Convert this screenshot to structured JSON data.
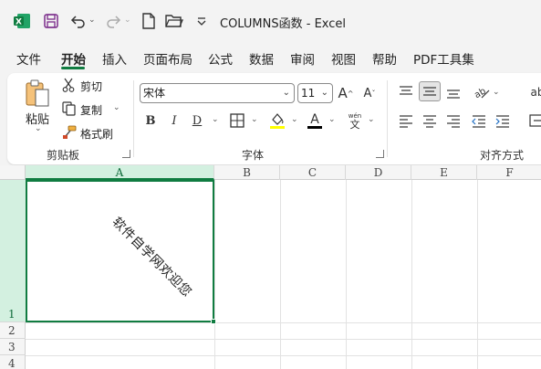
{
  "window": {
    "title": "COLUMNS函数  -  Excel"
  },
  "tabs": [
    {
      "label": "文件",
      "active": false
    },
    {
      "label": "开始",
      "active": true
    },
    {
      "label": "插入",
      "active": false
    },
    {
      "label": "页面布局",
      "active": false
    },
    {
      "label": "公式",
      "active": false
    },
    {
      "label": "数据",
      "active": false
    },
    {
      "label": "审阅",
      "active": false
    },
    {
      "label": "视图",
      "active": false
    },
    {
      "label": "帮助",
      "active": false
    },
    {
      "label": "PDF工具集",
      "active": false
    }
  ],
  "clipboard": {
    "group_label": "剪贴板",
    "paste": "粘贴",
    "cut": "剪切",
    "copy": "复制",
    "format_painter": "格式刷"
  },
  "font": {
    "group_label": "字体",
    "font_name": "宋体",
    "font_size": "11",
    "bold": "B",
    "italic": "I",
    "underline": "D",
    "phonetic_top": "wén",
    "phonetic_bottom": "文"
  },
  "alignment": {
    "group_label": "对齐方式"
  },
  "columns": [
    "A",
    "B",
    "C",
    "D",
    "E",
    "F"
  ],
  "rows": [
    "1",
    "2",
    "3",
    "4"
  ],
  "cells": {
    "A1": "软件自学网欢迎您"
  },
  "colors": {
    "accent": "#107c41",
    "font_color_bar": "#000000",
    "fill_color_bar": "#ffff00"
  }
}
